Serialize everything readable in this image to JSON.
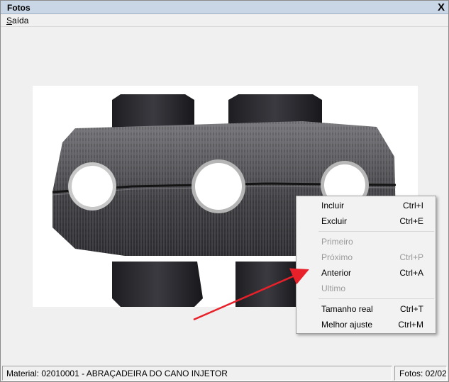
{
  "window": {
    "title": "Fotos",
    "close_glyph": "X"
  },
  "menubar": {
    "items": [
      {
        "underline": "S",
        "rest": "aída"
      }
    ]
  },
  "photo": {
    "subject_icon": "clamp-photo",
    "colors": {
      "metal_dark": "#2c2c30",
      "metal_light": "#a5a5a5",
      "background": "#ffffff"
    }
  },
  "context_menu": {
    "items": [
      {
        "label": "Incluir",
        "shortcut": "Ctrl+I",
        "enabled": true
      },
      {
        "label": "Excluir",
        "shortcut": "Ctrl+E",
        "enabled": true
      },
      {
        "label": "Primeiro",
        "shortcut": "",
        "enabled": false
      },
      {
        "label": "Próximo",
        "shortcut": "Ctrl+P",
        "enabled": false
      },
      {
        "label": "Anterior",
        "shortcut": "Ctrl+A",
        "enabled": true
      },
      {
        "label": "Ultimo",
        "shortcut": "",
        "enabled": false
      },
      {
        "label": "Tamanho real",
        "shortcut": "Ctrl+T",
        "enabled": true
      },
      {
        "label": "Melhor ajuste",
        "shortcut": "Ctrl+M",
        "enabled": true
      }
    ]
  },
  "annotation": {
    "type": "red-arrow",
    "color": "#e8202a"
  },
  "statusbar": {
    "material": "Material: 02010001 - ABRAÇADEIRA DO CANO INJETOR",
    "photos": "Fotos:  02/02"
  }
}
